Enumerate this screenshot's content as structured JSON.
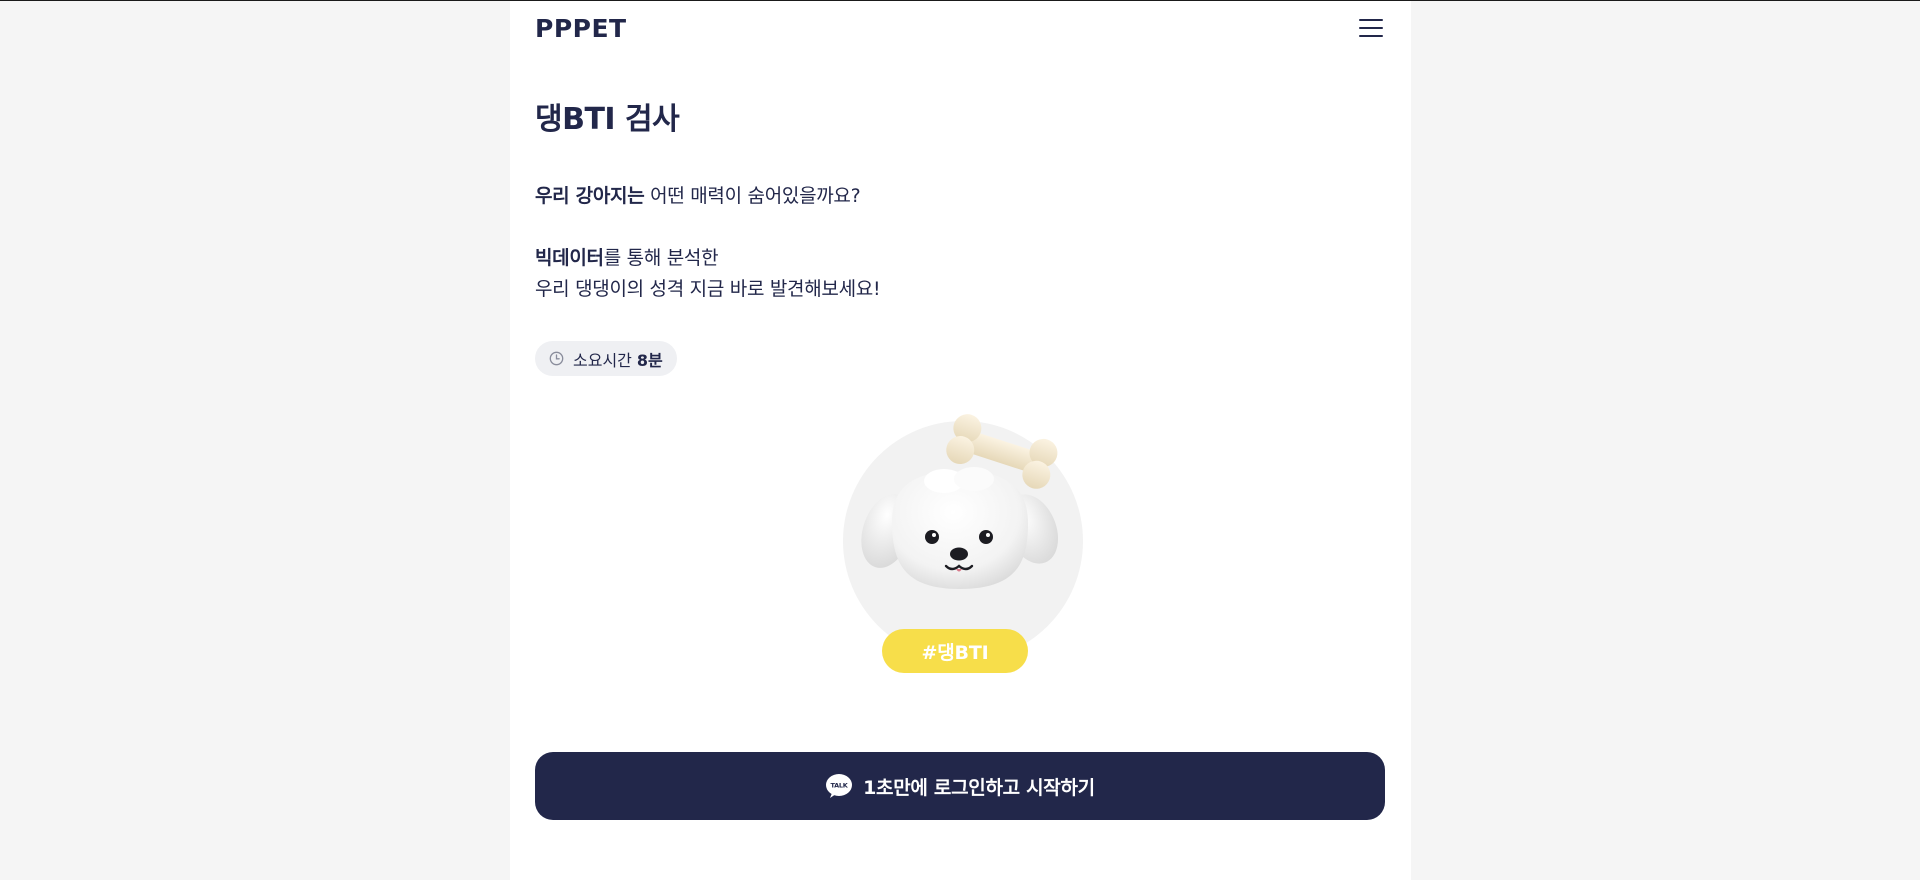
{
  "header": {
    "logo": "PPPET",
    "menu_icon": "hamburger-menu-icon"
  },
  "main": {
    "title": "댕BTI 검사",
    "intro": {
      "line1_bold": "우리 강아지는",
      "line1_rest": " 어떤 매력이 숨어있을까요?",
      "line2_bold": "빅데이터",
      "line2_rest": "를 통해 분석한",
      "line3": "우리 댕댕이의 성격 지금 바로 발견해보세요!"
    },
    "duration": {
      "icon": "clock-icon",
      "label": "소요시간",
      "value": "8분"
    },
    "hero": {
      "image": "white-puppy-with-bone",
      "hashtag": "#댕BTI"
    },
    "start_button": {
      "icon": "kakao-talk-icon",
      "label": "1초만에 로그인하고 시작하기"
    }
  },
  "colors": {
    "navy": "#22274a",
    "yellow": "#f7de4a",
    "page_bg": "#f5f5f5",
    "pill_bg": "#eff0f3"
  }
}
